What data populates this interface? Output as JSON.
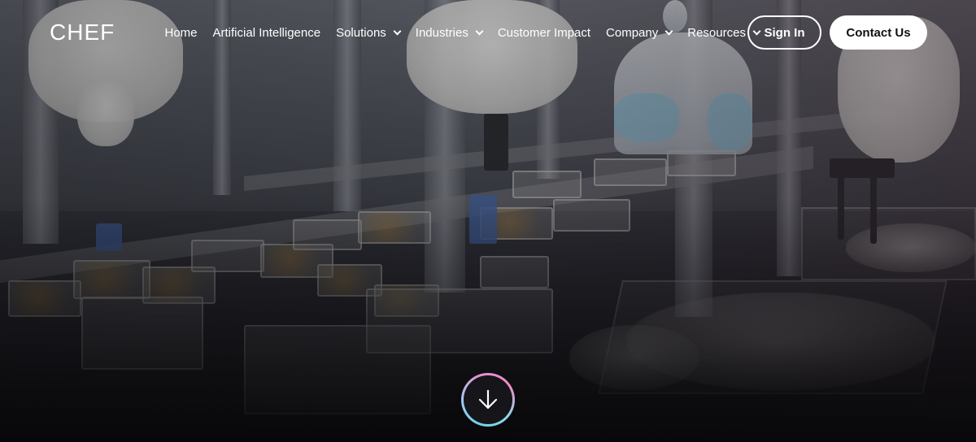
{
  "brand": {
    "logo": "CHEF"
  },
  "nav": {
    "items": [
      {
        "label": "Home",
        "has_dropdown": false
      },
      {
        "label": "Artificial Intelligence",
        "has_dropdown": false
      },
      {
        "label": "Solutions",
        "has_dropdown": true
      },
      {
        "label": "Industries",
        "has_dropdown": true
      },
      {
        "label": "Customer Impact",
        "has_dropdown": false
      },
      {
        "label": "Company",
        "has_dropdown": true
      },
      {
        "label": "Resources",
        "has_dropdown": true
      }
    ],
    "sign_in_label": "Sign In",
    "contact_label": "Contact Us"
  },
  "hero": {
    "background": "food production line with robotic arms and workers",
    "scroll_icon": "arrow-down-icon"
  },
  "colors": {
    "text": "#ffffff",
    "contact_bg": "#ffffff",
    "contact_text": "#111111",
    "scroll_ring": [
      "#6fd3e8",
      "#e58fd0"
    ]
  }
}
